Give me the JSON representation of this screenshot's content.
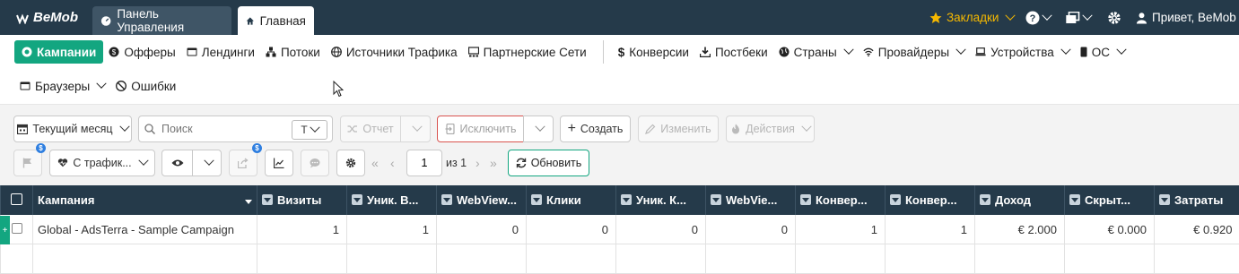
{
  "topbar": {
    "logo": "BeMob",
    "tabs": [
      {
        "label": "Панель Управления",
        "icon": "speedometer-icon"
      },
      {
        "label": "Главная",
        "icon": "home-icon"
      }
    ],
    "bookmarks": "Закладки",
    "greeting": "Привет, BeMob",
    "colors": {
      "background": "#253a4a",
      "bookmarks": "#f5b800"
    }
  },
  "nav": {
    "row1": [
      {
        "label": "Кампании",
        "icon": "campaigns-icon",
        "active": true
      },
      {
        "label": "Офферы",
        "icon": "dollar-circle-icon"
      },
      {
        "label": "Лендинги",
        "icon": "landing-icon"
      },
      {
        "label": "Потоки",
        "icon": "flows-icon"
      },
      {
        "label": "Источники Трафика",
        "icon": "globe-icon"
      },
      {
        "label": "Партнерские Сети",
        "icon": "network-icon"
      },
      {
        "label": "Конверсии",
        "icon": "dollar-icon"
      },
      {
        "label": "Постбеки",
        "icon": "download-icon"
      },
      {
        "label": "Страны",
        "icon": "globe-icon",
        "dropdown": true
      },
      {
        "label": "Провайдеры",
        "icon": "wifi-icon",
        "dropdown": true
      },
      {
        "label": "Устройства",
        "icon": "laptop-icon",
        "dropdown": true
      },
      {
        "label": "ОС",
        "icon": "mobile-icon",
        "dropdown": true
      }
    ],
    "row2": [
      {
        "label": "Браузеры",
        "icon": "browser-icon",
        "dropdown": true
      },
      {
        "label": "Ошибки",
        "icon": "bug-icon"
      }
    ],
    "accent": "#13a680"
  },
  "toolbar": {
    "period": "Текущий месяц",
    "search_placeholder": "Поиск",
    "search_type": "T",
    "report": "Отчет",
    "exclude": "Исключить",
    "create": "Создать",
    "edit": "Изменить",
    "actions": "Действия",
    "traffic_filter": "С трафик...",
    "page_value": "1",
    "page_of": "из 1",
    "refresh": "Обновить",
    "badge": "$"
  },
  "table": {
    "columns": [
      "Кампания",
      "Визиты",
      "Уник. В...",
      "WebView...",
      "Клики",
      "Уник. К...",
      "WebVie...",
      "Конвер...",
      "Конвер...",
      "Доход",
      "Скрыт...",
      "Затраты"
    ],
    "rows": [
      [
        "Global - AdsTerra - Sample Campaign",
        "1",
        "1",
        "0",
        "0",
        "0",
        "0",
        "1",
        "1",
        "€ 2.000",
        "€ 0.000",
        "€ 0.920"
      ]
    ]
  }
}
